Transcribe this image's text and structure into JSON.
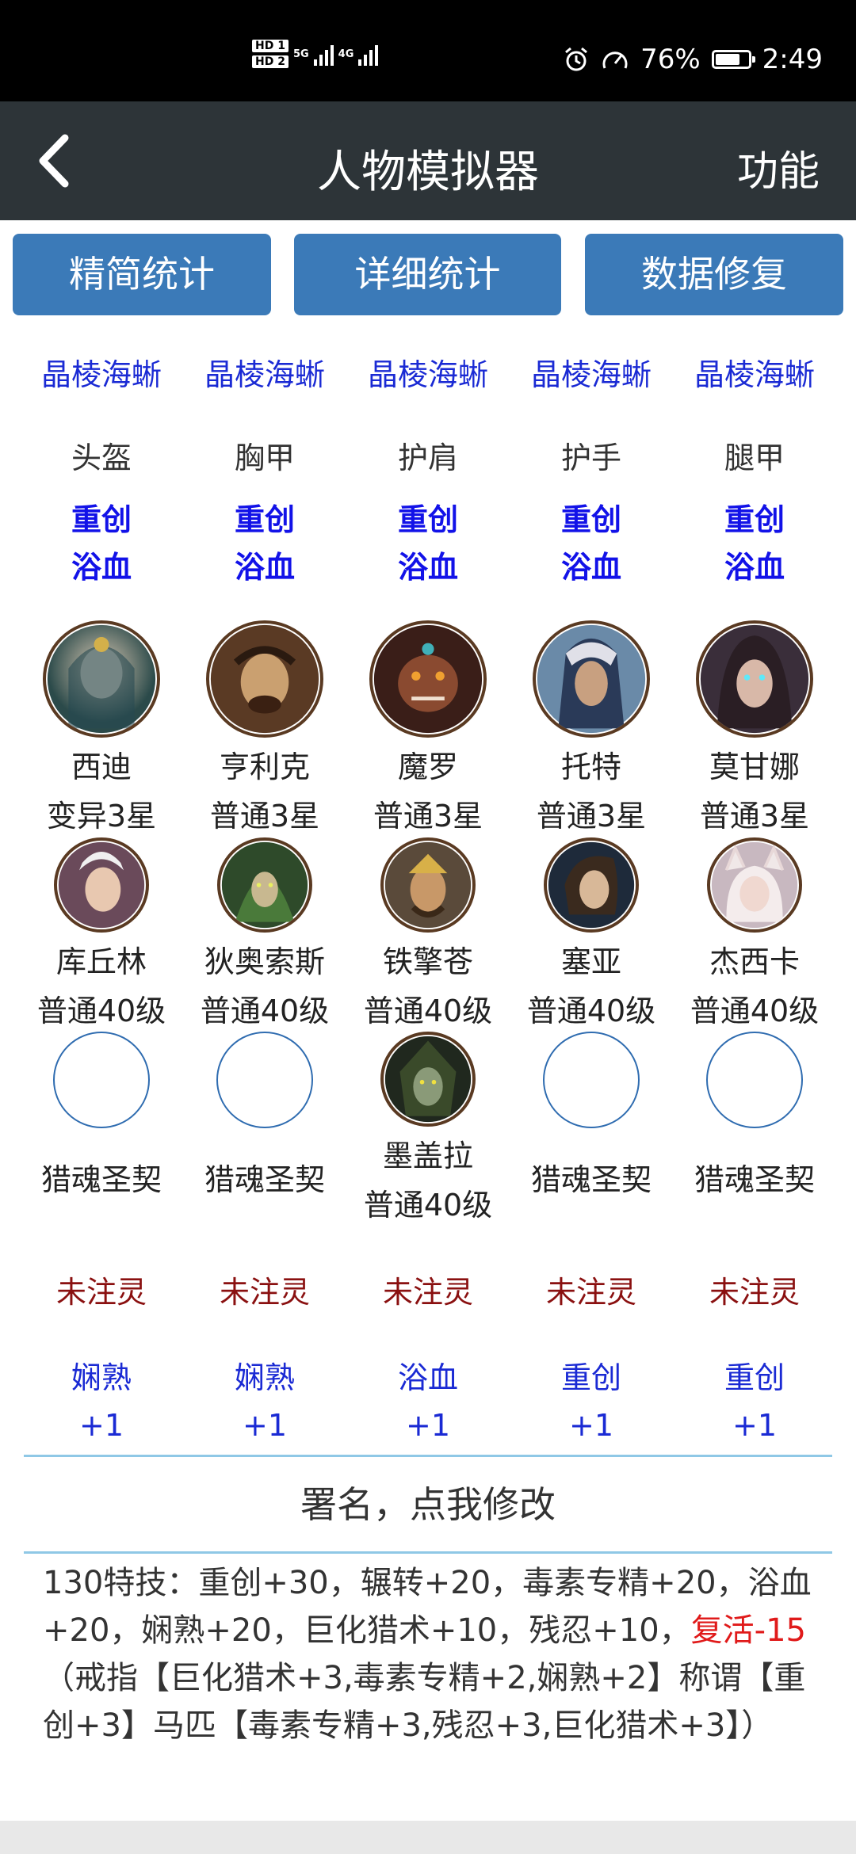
{
  "status_bar": {
    "hd1": "HD 1",
    "hd2": "HD 2",
    "net1": "5G",
    "net2": "4G",
    "battery_percent": "76%",
    "battery_level": 0.76,
    "time": "2:49",
    "alarm_icon": "alarm-icon",
    "speed_icon": "speedometer-icon"
  },
  "app_bar": {
    "title": "人物模拟器",
    "action": "功能",
    "back_icon": "chevron-left-icon"
  },
  "buttons": [
    "精简统计",
    "详细统计",
    "数据修复"
  ],
  "columns": [
    {
      "gear": "晶棱海蜥",
      "slot": "头盔",
      "affix1": "重创",
      "affix2": "浴血",
      "hero1": {
        "name": "西迪",
        "grade": "变异3星"
      },
      "hero2": {
        "name": "库丘林",
        "grade": "普通40级"
      },
      "soul": {
        "name": "猎魂圣契",
        "grade": ""
      },
      "spirit": "未注灵",
      "bonus_name": "娴熟",
      "bonus_value": "+1"
    },
    {
      "gear": "晶棱海蜥",
      "slot": "胸甲",
      "affix1": "重创",
      "affix2": "浴血",
      "hero1": {
        "name": "亨利克",
        "grade": "普通3星"
      },
      "hero2": {
        "name": "狄奥索斯",
        "grade": "普通40级"
      },
      "soul": {
        "name": "猎魂圣契",
        "grade": ""
      },
      "spirit": "未注灵",
      "bonus_name": "娴熟",
      "bonus_value": "+1"
    },
    {
      "gear": "晶棱海蜥",
      "slot": "护肩",
      "affix1": "重创",
      "affix2": "浴血",
      "hero1": {
        "name": "魔罗",
        "grade": "普通3星"
      },
      "hero2": {
        "name": "铁擎苍",
        "grade": "普通40级"
      },
      "soul": {
        "name": "墨盖拉",
        "grade": "普通40级"
      },
      "spirit": "未注灵",
      "bonus_name": "浴血",
      "bonus_value": "+1"
    },
    {
      "gear": "晶棱海蜥",
      "slot": "护手",
      "affix1": "重创",
      "affix2": "浴血",
      "hero1": {
        "name": "托特",
        "grade": "普通3星"
      },
      "hero2": {
        "name": "塞亚",
        "grade": "普通40级"
      },
      "soul": {
        "name": "猎魂圣契",
        "grade": ""
      },
      "spirit": "未注灵",
      "bonus_name": "重创",
      "bonus_value": "+1"
    },
    {
      "gear": "晶棱海蜥",
      "slot": "腿甲",
      "affix1": "重创",
      "affix2": "浴血",
      "hero1": {
        "name": "莫甘娜",
        "grade": "普通3星"
      },
      "hero2": {
        "name": "杰西卡",
        "grade": "普通40级"
      },
      "soul": {
        "name": "猎魂圣契",
        "grade": ""
      },
      "spirit": "未注灵",
      "bonus_name": "重创",
      "bonus_value": "+1"
    }
  ],
  "signature": "署名，点我修改",
  "summary": {
    "part1": "130特技：重创+30，辗转+20，毒素专精+20，浴血+20，娴熟+20，巨化猎术+10，残忍+10，",
    "red": "复活-15",
    "part2": "（戒指【巨化猎术+3,毒素专精+2,娴熟+2】称谓【重创+3】马匹【毒素专精+3,残忍+3,巨化猎术+3】）"
  },
  "colors": {
    "status_bg": "#000000",
    "appbar_bg": "#2d3438",
    "button_bg": "#3b7ab8",
    "link_blue": "#1a2ad4",
    "affix_blue": "#1212e8",
    "spirit_red": "#8a1010",
    "alert_red": "#e01a1a",
    "divider": "#8fc8e6"
  }
}
